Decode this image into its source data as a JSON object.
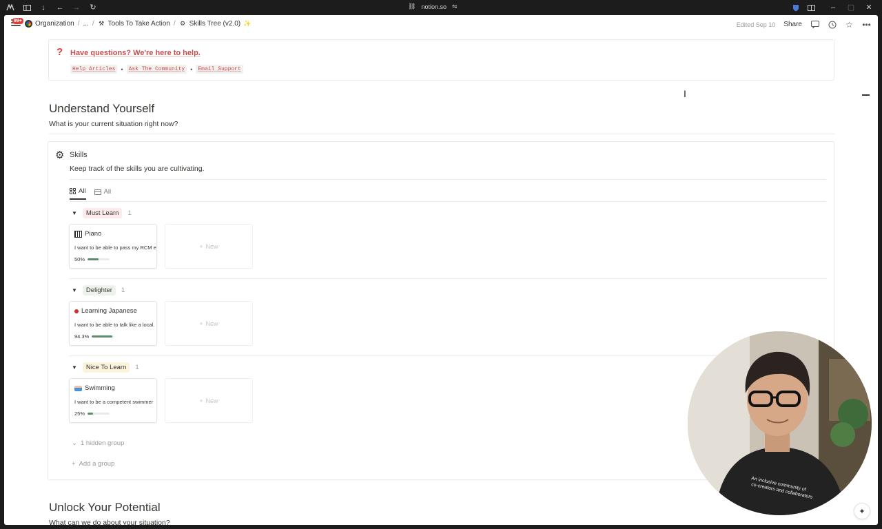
{
  "browser": {
    "url": "notion.so"
  },
  "breadcrumb": {
    "badge": "99+",
    "items": [
      "Organization",
      "...",
      "Tools To Take Action",
      "Skills Tree (v2.0)"
    ],
    "sparkle": "✨"
  },
  "topbar": {
    "edited": "Edited Sep 10",
    "share": "Share"
  },
  "callout": {
    "title": "Have questions? We're here to help.",
    "links": [
      "Help Articles",
      "Ask The Community",
      "Email Support"
    ],
    "separator": "•"
  },
  "section1": {
    "heading": "Understand Yourself",
    "subheading": "What is your current situation right now?"
  },
  "skills": {
    "title": "Skills",
    "description": "Keep track of the skills you are cultivating.",
    "tabs": [
      "All",
      "All"
    ],
    "groups": [
      {
        "label": "Must Learn",
        "count": "1",
        "color": "#fdebec",
        "card": {
          "title": "Piano",
          "desc": "I want to be able to pass my RCM exam",
          "progress_label": "50%",
          "progress": 0.5
        }
      },
      {
        "label": "Delighter",
        "count": "1",
        "color": "#edf3ec",
        "card": {
          "title": "Learning Japanese",
          "desc": "I want to be able to talk like a local.",
          "progress_label": "94.3%",
          "progress": 0.943
        }
      },
      {
        "label": "Nice To Learn",
        "count": "1",
        "color": "#fbf3db",
        "card": {
          "title": "Swimming",
          "desc": "I want to be a competent swimmer",
          "progress_label": "25%",
          "progress": 0.25
        }
      }
    ],
    "new_label": "New",
    "hidden_group": "1 hidden group",
    "add_group": "Add a group"
  },
  "section2": {
    "heading": "Unlock Your Potential",
    "subheading": "What can we do about your situation?"
  }
}
